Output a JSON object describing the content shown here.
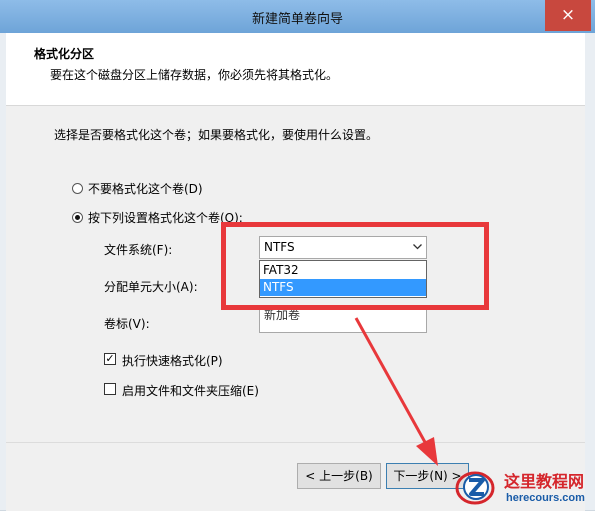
{
  "window": {
    "title": "新建简单卷向导",
    "close_glyph": "×"
  },
  "header": {
    "title": "格式化分区",
    "subtitle": "要在这个磁盘分区上储存数据，你必须先将其格式化。"
  },
  "body": {
    "instruction": "选择是否要格式化这个卷；如果要格式化，要使用什么设置。",
    "options": [
      {
        "label": "不要格式化这个卷(D)",
        "selected": false
      },
      {
        "label": "按下列设置格式化这个卷(O):",
        "selected": true
      }
    ],
    "filesystem_label": "文件系统(F):",
    "filesystem_value": "NTFS",
    "filesystem_options": [
      "FAT32",
      "NTFS"
    ],
    "allocation_label": "分配单元大小(A):",
    "volume_label_label": "卷标(V):",
    "volume_label_value": "新加卷",
    "quick_format_label": "执行快速格式化(P)",
    "quick_format_checked": true,
    "compression_label": "启用文件和文件夹压缩(E)",
    "compression_checked": false
  },
  "footer": {
    "back_label": "< 上一步(B)",
    "next_label": "下一步(N) >"
  },
  "watermark": {
    "name": "这里教程网",
    "url": "herecours.com"
  },
  "colors": {
    "annotation_red": "#e8383b",
    "selection_blue": "#3399ff",
    "close_red": "#c8483e"
  }
}
